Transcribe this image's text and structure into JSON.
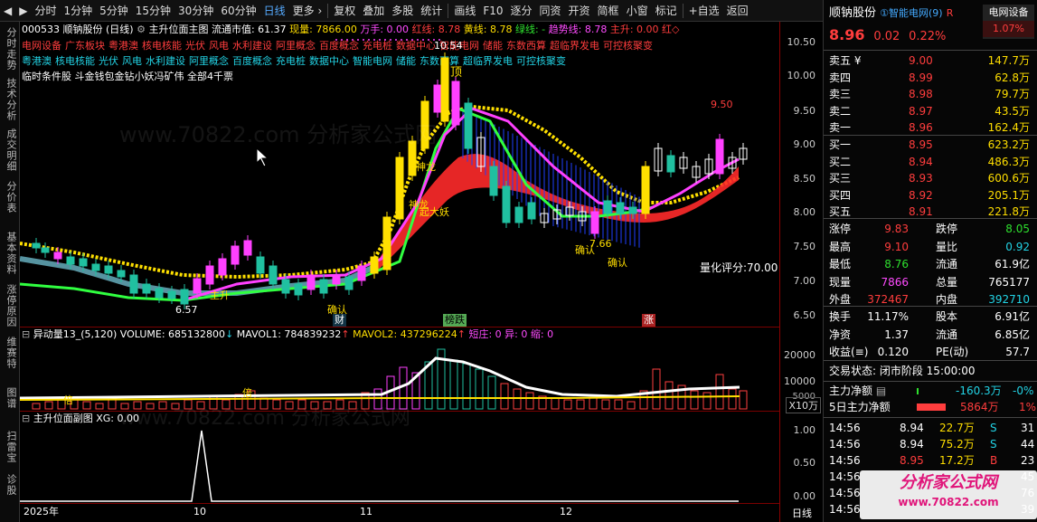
{
  "toolbar": {
    "nav_back": "◀",
    "nav_forward": "▶",
    "items": [
      "分时",
      "1分钟",
      "5分钟",
      "15分钟",
      "30分钟",
      "60分钟",
      "日线",
      "更多 ›",
      "复权",
      "叠加",
      "多股",
      "统计",
      "画线",
      "F10",
      "逐分",
      "同资",
      "开资",
      "简框",
      "小窗",
      "标记",
      "+自选",
      "返回"
    ],
    "active": "日线"
  },
  "left_tabs": [
    "分时走势",
    "技术分析",
    "成交明细",
    "分价表",
    "基本资料",
    "涨停原因",
    "维赛特",
    "图谱",
    "扫雷宝",
    "诊股"
  ],
  "main": {
    "code": "000533 顺钠股份 (日线)",
    "indicator_name": "主升位面主图",
    "float_mv": "流通市值: 61.37",
    "volume_now": "现量: 7866.00",
    "wan_shou": "万手: 0.00",
    "red_line": "红线: 8.78",
    "yellow_line": "黄线: 8.78",
    "green_line": "绿线: -",
    "trend_line": "趋势线: 8.78",
    "main_up": "主升: 0.00",
    "red_label": "红◇",
    "concepts_row1": [
      "电网设备",
      "广东板块",
      "粤港澳",
      "核电核能",
      "光伏",
      "风电",
      "水利建设",
      "阿里概念",
      "百度概念",
      "充电桩",
      "数据中心",
      "智能电网",
      "储能",
      "东数西算",
      "超临界发电",
      "可控核聚变"
    ],
    "concepts_row2": [
      "粤港澳",
      "核电核能",
      "光伏",
      "风电",
      "水利建设",
      "阿里概念",
      "百度概念",
      "充电桩",
      "数据中心",
      "智能电网",
      "储能",
      "东数西算",
      "超临界发电",
      "可控核聚变"
    ],
    "condition_line": "临时条件股 斗金钱包金钻小妖冯矿伟 全部4千票",
    "annotations": {
      "high": "10.54",
      "top": "顶",
      "shenlong": "神龙",
      "shenlong2": "神龙",
      "dayao": "起大妖",
      "queren1": "确认",
      "queren2": "确认",
      "queren3": "确认",
      "low_price": "7.66",
      "mid_high": "9.50",
      "zhusheng": "主升",
      "low_left": "6.57",
      "score": "量化评分:70.00",
      "cai": "财",
      "bangdie": "榜跌",
      "zhang": "涨"
    },
    "price_axis": [
      "10.50",
      "10.00",
      "9.50",
      "9.00",
      "8.50",
      "8.00",
      "7.50",
      "7.00",
      "6.50"
    ]
  },
  "volume_panel": {
    "title": "异动量13_(5,120)",
    "volume": "VOLUME: 685132800",
    "volume_arrow": "↓",
    "mavol1": "MAVOL1: 784839232",
    "mavol1_arrow": "↑",
    "mavol2": "MAVOL2: 437296224",
    "mavol2_arrow": "↑",
    "short": "短庄: 0",
    "abnormal": "异: 0",
    "shrink": "缩: 0",
    "axis": [
      "20000",
      "10000",
      "5000"
    ],
    "unit": "X10万",
    "bei": "倍"
  },
  "sub_panel": {
    "title": "主升位面副图",
    "xg": "XG: 0.00",
    "axis": [
      "1.00",
      "0.50",
      "0.00"
    ]
  },
  "time_axis": [
    "2025年",
    "10",
    "11",
    "12"
  ],
  "period": "日线",
  "quote": {
    "name": "顺钠股份",
    "tag": "①智能电网(9)",
    "r": "R",
    "sector": "电网设备",
    "sector_pct": "1.07%",
    "price": "8.96",
    "change": "0.02",
    "pct": "0.22%",
    "asks": [
      {
        "label": "卖五 ¥",
        "price": "9.00",
        "vol": "147.7万"
      },
      {
        "label": "卖四",
        "price": "8.99",
        "vol": "62.8万"
      },
      {
        "label": "卖三",
        "price": "8.98",
        "vol": "79.7万"
      },
      {
        "label": "卖二",
        "price": "8.97",
        "vol": "43.5万"
      },
      {
        "label": "卖一",
        "price": "8.96",
        "vol": "162.4万"
      }
    ],
    "bids": [
      {
        "label": "买一",
        "price": "8.95",
        "vol": "623.2万"
      },
      {
        "label": "买二",
        "price": "8.94",
        "vol": "486.3万"
      },
      {
        "label": "买三",
        "price": "8.93",
        "vol": "600.6万"
      },
      {
        "label": "买四",
        "price": "8.92",
        "vol": "205.1万"
      },
      {
        "label": "买五",
        "price": "8.91",
        "vol": "221.8万"
      }
    ],
    "stats1": [
      {
        "k": "涨停",
        "v": "9.83",
        "k2": "跌停",
        "v2": "8.05"
      },
      {
        "k": "最高",
        "v": "9.10",
        "k2": "量比",
        "v2": "0.92"
      },
      {
        "k": "最低",
        "v": "8.76",
        "k2": "流通",
        "v2": "61.9亿"
      },
      {
        "k": "现量",
        "v": "7866",
        "k2": "总量",
        "v2": "765177"
      },
      {
        "k": "外盘",
        "v": "372467",
        "k2": "内盘",
        "v2": "392710"
      }
    ],
    "stats2": [
      {
        "k": "换手",
        "v": "11.17%",
        "k2": "股本",
        "v2": "6.91亿"
      },
      {
        "k": "净资",
        "v": "1.37",
        "k2": "流通",
        "v2": "6.85亿"
      },
      {
        "k": "收益(≡)",
        "v": "0.120",
        "k2": "PE(动)",
        "v2": "57.7"
      }
    ],
    "trade_status": "交易状态: 闭市阶段 15:00:00",
    "net_main_label": "主力净额",
    "net_main_val": "-160.3万",
    "net_main_pct": "-0%",
    "net5_label": "5日主力净额",
    "net5_val": "5864万",
    "net5_pct": "1%",
    "ticks": [
      {
        "t": "14:56",
        "p": "8.94",
        "v": "22.7万",
        "s": "S",
        "n": "31"
      },
      {
        "t": "14:56",
        "p": "8.94",
        "v": "75.2万",
        "s": "S",
        "n": "44"
      },
      {
        "t": "14:56",
        "p": "8.95",
        "v": "17.2万",
        "s": "B",
        "n": "23"
      },
      {
        "t": "14:56",
        "p": "",
        "v": "",
        "s": "",
        "n": "45"
      },
      {
        "t": "14:56",
        "p": "",
        "v": "",
        "s": "",
        "n": "76"
      },
      {
        "t": "14:56",
        "p": "",
        "v": "",
        "s": "",
        "n": "39"
      }
    ],
    "watermark": "分析家公式网",
    "watermark_url": "www.70822.com"
  }
}
